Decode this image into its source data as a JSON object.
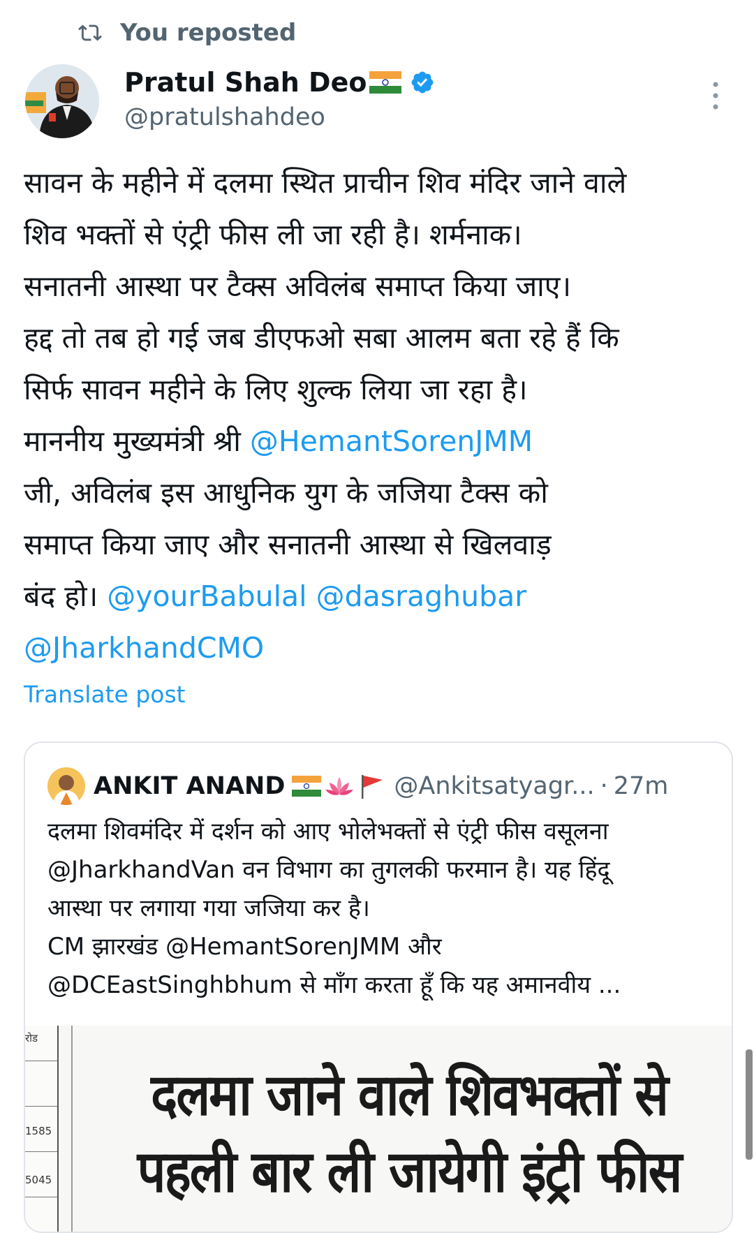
{
  "repost": {
    "label": "You reposted",
    "icon": "repost-icon"
  },
  "author": {
    "name": "Pratul Shah Deo",
    "handle": "@pratulshahdeo",
    "verified": true,
    "flag": "india-flag-icon"
  },
  "tweet": {
    "lines": [
      [
        {
          "t": "सावन के महीने में दलमा स्थित प्राचीन शिव मंदिर जाने वाले",
          "m": false
        }
      ],
      [
        {
          "t": "शिव भक्तों से एंट्री फीस ली जा रही है। शर्मनाक।",
          "m": false
        }
      ],
      [
        {
          "t": "सनातनी आस्था पर टैक्स अविलंब समाप्त किया जाए।",
          "m": false
        }
      ],
      [
        {
          "t": "हद्द तो तब हो गई जब डीएफओ सबा आलम बता रहे हैं कि",
          "m": false
        }
      ],
      [
        {
          "t": "सिर्फ सावन महीने के लिए शुल्क लिया जा रहा है।",
          "m": false
        }
      ],
      [
        {
          "t": "माननीय मुख्यमंत्री श्री ",
          "m": false
        },
        {
          "t": "@HemantSorenJMM",
          "m": true
        }
      ],
      [
        {
          "t": "जी, अविलंब इस आधुनिक युग के जजिया टैक्स को",
          "m": false
        }
      ],
      [
        {
          "t": "समाप्त किया जाए और सनातनी आस्था से खिलवाड़",
          "m": false
        }
      ],
      [
        {
          "t": "बंद हो। ",
          "m": false
        },
        {
          "t": "@yourBabulal",
          "m": true
        },
        {
          "t": " ",
          "m": false
        },
        {
          "t": "@dasraghubar",
          "m": true
        }
      ],
      [
        {
          "t": "@JharkhandCMO",
          "m": true
        }
      ]
    ],
    "translate_label": "Translate post"
  },
  "quote": {
    "name": "ANKIT ANAND",
    "emojis": [
      "india-flag-icon",
      "lotus-icon",
      "saffron-flag-icon"
    ],
    "handle": "@Ankitsatyagr...",
    "dot": "·",
    "time": "27m",
    "lines": [
      "दलमा शिवमंदिर में दर्शन को आए भोलेभक्तों से एंट्री फीस वसूलना",
      "@JharkhandVan वन विभाग का तुगलकी फरमान है। यह हिंदू",
      "आस्था पर लगाया गया जजिया कर है।",
      "CM झारखंड @HemantSorenJMM और",
      "@DCEastSinghbhum से माँग करता हूँ कि यह अमानवीय ..."
    ],
    "media": {
      "strip_labels": [
        "रोड",
        "1585",
        "5045"
      ],
      "headline_1": "दलमा जाने वाले शिवभक्तों से",
      "headline_2": "पहली बार ली जायेगी इंट्री फीस"
    }
  },
  "colors": {
    "link": "#1d9bf0",
    "secondary_text": "#536471",
    "primary_text": "#0f1419",
    "border": "#dfe4e8"
  }
}
